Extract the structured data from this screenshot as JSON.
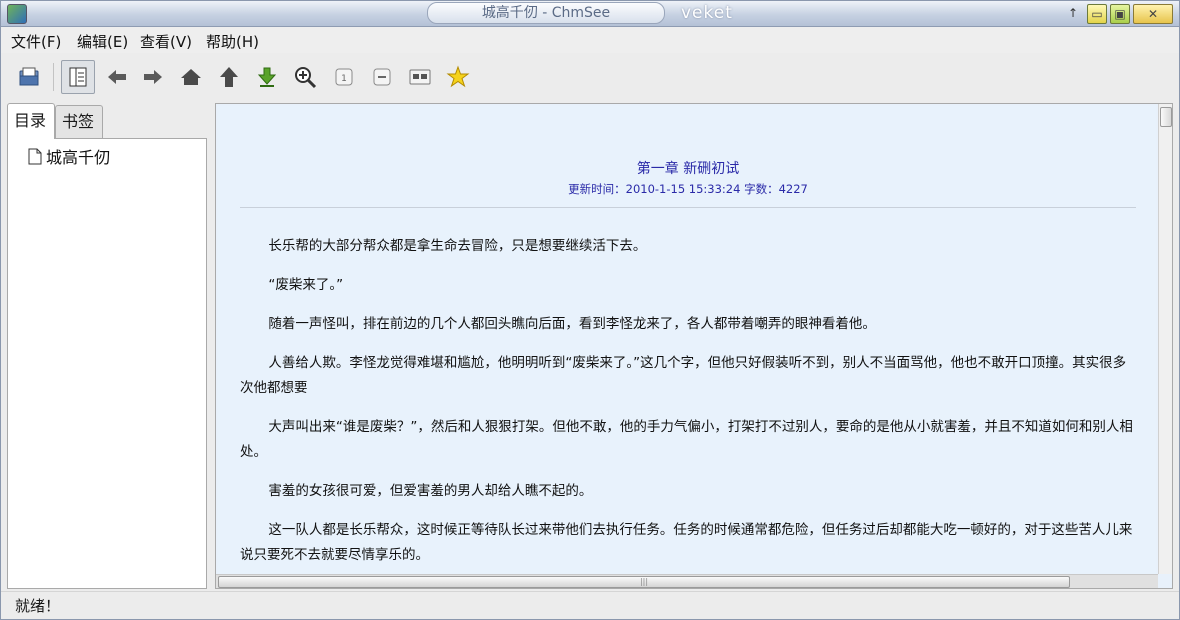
{
  "titlebar": {
    "title": "城高千仞 - ChmSee",
    "extra_text": "veket",
    "colors": {
      "title_text": "#5b6b86",
      "min": "#e3d44a",
      "max": "#a9cf4b",
      "close": "#e7c44c"
    }
  },
  "menubar": {
    "items": [
      "文件(F)",
      "编辑(E)",
      "查看(V)",
      "帮助(H)"
    ]
  },
  "toolbar": {
    "icons": [
      "open-file-icon",
      "sidebar-toggle-icon",
      "back-arrow-icon",
      "forward-arrow-icon",
      "home-icon",
      "up-arrow-icon",
      "download-icon",
      "zoom-in-icon",
      "reset-zoom-icon",
      "zoom-out-icon",
      "split-view-icon",
      "favorite-star-icon"
    ]
  },
  "sidebar": {
    "tabs": [
      "目录",
      "书签"
    ],
    "active_tab": "目录",
    "tree": [
      {
        "label": "城高千仞",
        "icon": "document-icon"
      }
    ]
  },
  "content": {
    "chapter_title": "第一章 新硎初试",
    "meta": "更新时间：2010-1-15 15:33:24 字数：4227",
    "paragraphs": [
      "长乐帮的大部分帮众都是拿生命去冒险，只是想要继续活下去。",
      "“废柴来了。”",
      "随着一声怪叫，排在前边的几个人都回头瞧向后面，看到李怪龙来了，各人都带着嘲弄的眼神看着他。",
      "人善给人欺。李怪龙觉得难堪和尴尬，他明明听到“废柴来了。”这几个字，但他只好假装听不到，别人不当面骂他，他也不敢开口顶撞。其实很多次他都想要",
      "大声叫出来“谁是废柴？”，然后和人狠狠打架。但他不敢，他的手力气偏小，打架打不过别人，要命的是他从小就害羞，并且不知道如何和别人相处。",
      "害羞的女孩很可爱，但爱害羞的男人却给人瞧不起的。",
      "这一队人都是长乐帮众，这时候正等待队长过来带他们去执行任务。任务的时候通常都危险，但任务过后却都能大吃一顿好的，对于这些苦人儿来说只要死不去就要尽情享乐的。"
    ],
    "colors": {
      "background": "#e8f2fc",
      "heading": "#2a2aa8"
    }
  },
  "statusbar": {
    "text": "就绪！"
  }
}
